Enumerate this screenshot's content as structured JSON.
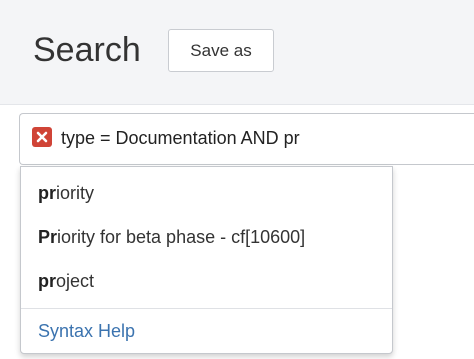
{
  "header": {
    "title": "Search",
    "save_as_label": "Save as"
  },
  "query": {
    "text": "type = Documentation AND pr",
    "error_icon": "error-x-icon",
    "error_color": "#d04437"
  },
  "suggestions": {
    "items": [
      {
        "match": "pr",
        "rest": "iority"
      },
      {
        "match": "Pr",
        "rest": "iority for beta phase - cf[10600]"
      },
      {
        "match": "pr",
        "rest": "oject"
      }
    ],
    "syntax_help_label": "Syntax Help",
    "link_color": "#3b73af"
  }
}
